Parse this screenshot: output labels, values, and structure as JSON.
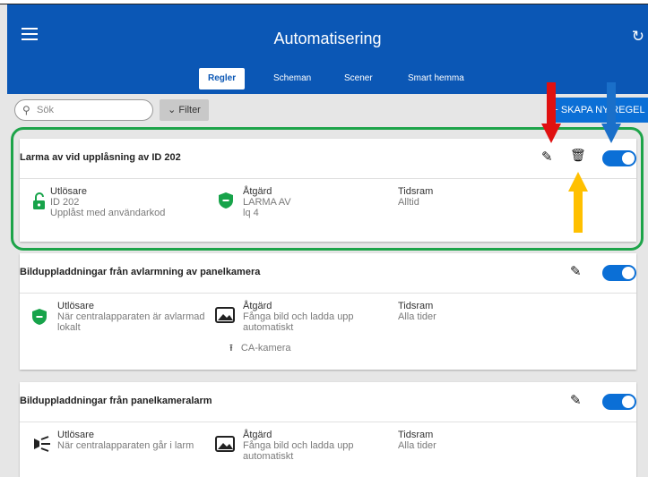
{
  "header": {
    "title": "Automatisering",
    "tabs": [
      {
        "label": "Regler",
        "active": true
      },
      {
        "label": "Scheman",
        "active": false
      },
      {
        "label": "Scener",
        "active": false
      },
      {
        "label": "Smart hemma",
        "active": false
      }
    ]
  },
  "toolbar": {
    "search_placeholder": "Sök",
    "filter_label": "Filter",
    "create_label": "+ SKAPA NY REGEL"
  },
  "rules": [
    {
      "title": "Larma av vid upplåsning av ID 202",
      "enabled": true,
      "trigger": {
        "label": "Utlösare",
        "lines": [
          "ID 202",
          "Upplåst med användarkod"
        ]
      },
      "action": {
        "label": "Åtgärd",
        "lines": [
          "LARMA AV",
          "lq 4"
        ]
      },
      "timeframe": {
        "label": "Tidsram",
        "value": "Alltid"
      }
    },
    {
      "title": "Bilduppladdningar från avlarmning av panelkamera",
      "enabled": true,
      "trigger": {
        "label": "Utlösare",
        "lines": [
          "När centralapparaten är avlarmad",
          "lokalt"
        ]
      },
      "action": {
        "label": "Åtgärd",
        "lines": [
          "Fånga bild och ladda upp",
          "automatiskt"
        ],
        "extra": "CA-kamera"
      },
      "timeframe": {
        "label": "Tidsram",
        "value": "Alla tider"
      }
    },
    {
      "title": "Bilduppladdningar från panelkameralarm",
      "enabled": true,
      "trigger": {
        "label": "Utlösare",
        "lines": [
          "När centralapparaten går i larm"
        ]
      },
      "action": {
        "label": "Åtgärd",
        "lines": [
          "Fånga bild och ladda upp",
          "automatiskt"
        ]
      },
      "timeframe": {
        "label": "Tidsram",
        "value": "Alla tider"
      }
    }
  ],
  "colors": {
    "appbar": "#0b57b5",
    "accent": "#0b6fd6",
    "highlight_outline": "#1ea44a",
    "arrow_red": "#e01010",
    "arrow_blue": "#1a6fc9",
    "arrow_yellow": "#ffc000",
    "shield_green": "#17a34a"
  },
  "icons": [
    "menu-icon",
    "refresh-icon",
    "search-icon",
    "chevron-down-icon",
    "edit-icon",
    "delete-icon",
    "unlock-icon",
    "shield-icon",
    "image-icon",
    "upload-icon",
    "siren-icon"
  ]
}
